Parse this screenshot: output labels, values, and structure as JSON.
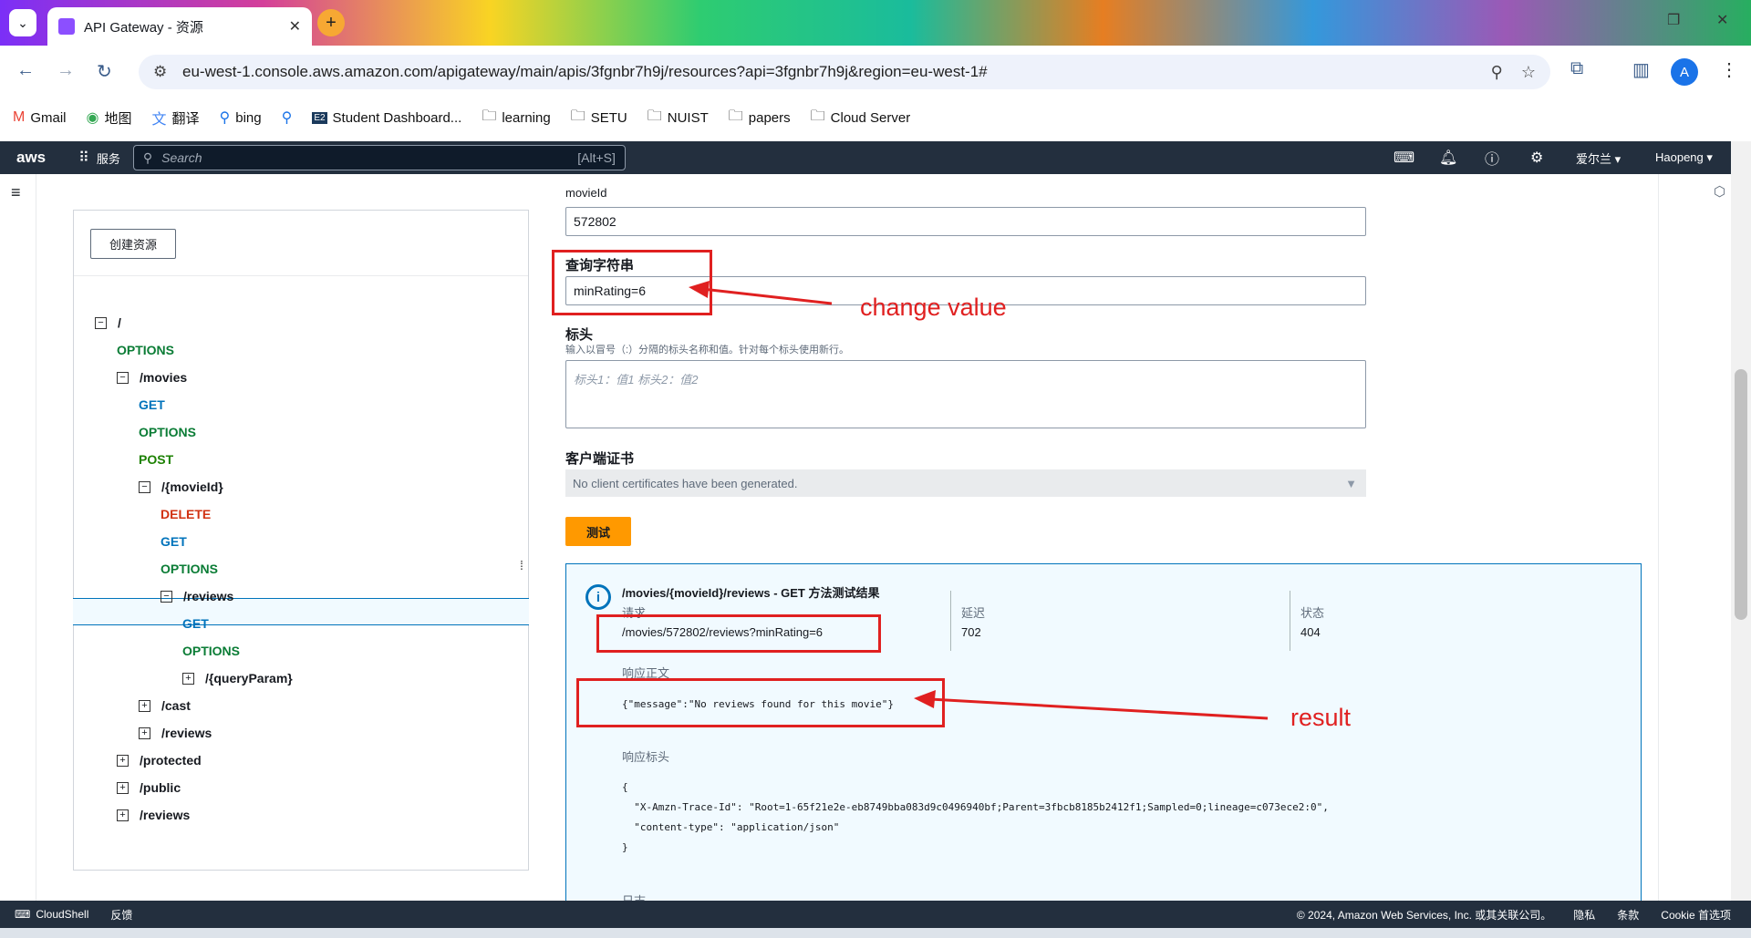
{
  "browser": {
    "tab_title": "API Gateway - 资源",
    "url": "eu-west-1.console.aws.amazon.com/apigateway/main/apis/3fgnbr7h9j/resources?api=3fgnbr7h9j&region=eu-west-1#",
    "profile_initial": "A",
    "bookmarks": [
      "Gmail",
      "地图",
      "翻译",
      "bing",
      "Student Dashboard...",
      "learning",
      "SETU",
      "NUIST",
      "papers",
      "Cloud Server"
    ]
  },
  "aws": {
    "logo": "aws",
    "services_label": "服务",
    "search_placeholder": "Search",
    "search_shortcut": "[Alt+S]",
    "region": "爱尔兰 ▾",
    "user": "Haopeng ▾"
  },
  "tree": {
    "create_button": "创建资源",
    "rows": [
      {
        "label": "/",
        "kind": "path"
      },
      {
        "label": "OPTIONS",
        "kind": "options"
      },
      {
        "label": "/movies",
        "kind": "path"
      },
      {
        "label": "GET",
        "kind": "get"
      },
      {
        "label": "OPTIONS",
        "kind": "options"
      },
      {
        "label": "POST",
        "kind": "post"
      },
      {
        "label": "/{movieId}",
        "kind": "path"
      },
      {
        "label": "DELETE",
        "kind": "delete"
      },
      {
        "label": "GET",
        "kind": "get"
      },
      {
        "label": "OPTIONS",
        "kind": "options"
      },
      {
        "label": "/reviews",
        "kind": "path"
      },
      {
        "label": "GET",
        "kind": "get"
      },
      {
        "label": "OPTIONS",
        "kind": "options"
      },
      {
        "label": "/{queryParam}",
        "kind": "path"
      },
      {
        "label": "/cast",
        "kind": "path"
      },
      {
        "label": "/reviews",
        "kind": "path"
      },
      {
        "label": "/protected",
        "kind": "path"
      },
      {
        "label": "/public",
        "kind": "path"
      },
      {
        "label": "/reviews",
        "kind": "path"
      }
    ]
  },
  "form": {
    "movie_id_label": "movieId",
    "movie_id_value": "572802",
    "query_label": "查询字符串",
    "query_value": "minRating=6",
    "headers_label": "标头",
    "headers_hint": "输入以冒号（:）分隔的标头名称和值。针对每个标头使用新行。",
    "headers_placeholder": "标头1：值1 标头2：值2",
    "cert_label": "客户端证书",
    "cert_value": "No client certificates have been generated.",
    "test_button": "测试"
  },
  "result": {
    "title": "/movies/{movieId}/reviews - GET 方法测试结果",
    "request_label": "请求",
    "request_value": "/movies/572802/reviews?minRating=6",
    "latency_label": "延迟",
    "latency_value": "702",
    "status_label": "状态",
    "status_value": "404",
    "body_label": "响应正文",
    "body_value": "{\"message\":\"No reviews found for this movie\"}",
    "headers_label": "响应标头",
    "headers_lines": [
      "{",
      "  \"X-Amzn-Trace-Id\": \"Root=1-65f21e2e-eb8749bba083d9c0496940bf;Parent=3fbcb8185b2412f1;Sampled=0;lineage=c073ece2:0\",",
      "  \"content-type\": \"application/json\"",
      "}"
    ],
    "log_label": "日志"
  },
  "annotations": {
    "change_value": "change value",
    "result": "result"
  },
  "footer": {
    "cloudshell": "CloudShell",
    "feedback": "反馈",
    "copyright": "© 2024, Amazon Web Services, Inc. 或其关联公司。",
    "privacy": "隐私",
    "terms": "条款",
    "cookie": "Cookie 首选项"
  }
}
